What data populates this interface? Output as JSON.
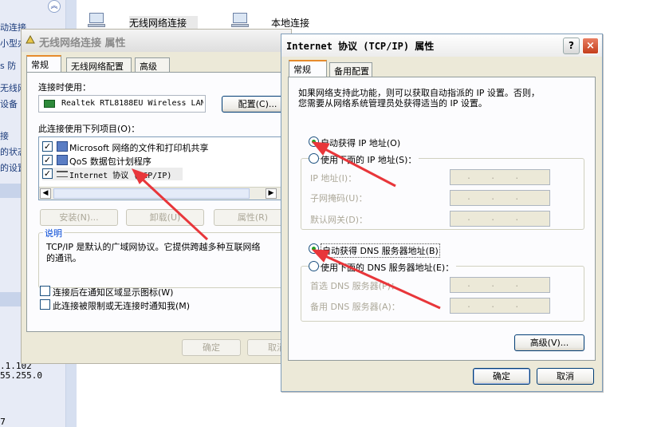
{
  "left_pane": {
    "lines": [
      "动连接",
      "小型办",
      "s 防",
      "无线网",
      "设备",
      "接",
      "的状态",
      "的设置"
    ],
    "ip_fragment": ".1.102",
    "mask_fragment": "55.255.0",
    "bottom_fragment": "7"
  },
  "network_items": [
    {
      "label": "无线网络连接"
    },
    {
      "label": "本地连接"
    }
  ],
  "wlan_dialog": {
    "title": "无线网络连接 属性",
    "tabs": [
      "常规",
      "无线网络配置",
      "高级"
    ],
    "connect_using_label": "连接时使用：",
    "adapter": "Realtek RTL8188EU Wireless LAN",
    "configure_button": "配置(C)...",
    "items_label": "此连接使用下列项目(O)：",
    "items": [
      {
        "label": "Microsoft 网络的文件和打印机共享",
        "checked": true
      },
      {
        "label": "QoS 数据包计划程序",
        "checked": true
      },
      {
        "label": "Internet 协议 (TCP/IP)",
        "checked": true
      }
    ],
    "install_button": "安装(N)...",
    "uninstall_button": "卸载(U)",
    "properties_button": "属性(R)",
    "description_title": "说明",
    "description_text_1": "TCP/IP 是默认的广域网协议。它提供跨越多种互联网络",
    "description_text_2": "的通讯。",
    "show_icon_label": "连接后在通知区域显示图标(W)",
    "notify_label": "此连接被限制或无连接时通知我(M)",
    "ok_button": "确定",
    "cancel_button": "取消"
  },
  "tcpip_dialog": {
    "title": "Internet 协议 (TCP/IP) 属性",
    "help_glyph": "?",
    "close_glyph": "×",
    "tabs": [
      "常规",
      "备用配置"
    ],
    "intro_1": "如果网络支持此功能，则可以获取自动指派的 IP 设置。否则，",
    "intro_2": "您需要从网络系统管理员处获得适当的 IP 设置。",
    "auto_ip_label": "自动获得 IP 地址(O)",
    "manual_ip_label": "使用下面的 IP 地址(S)：",
    "ip_address_label": "IP 地址(I)：",
    "subnet_label": "子网掩码(U)：",
    "gateway_label": "默认网关(D)：",
    "auto_dns_label": "自动获得 DNS 服务器地址(B)",
    "manual_dns_label": "使用下面的 DNS 服务器地址(E)：",
    "preferred_dns_label": "首选 DNS 服务器(P)：",
    "alternate_dns_label": "备用 DNS 服务器(A)：",
    "ip_placeholder": ".    .    .",
    "advanced_button": "高级(V)...",
    "ok_button": "确定",
    "cancel_button": "取消",
    "auto_ip_selected": true,
    "auto_dns_selected": true
  },
  "colors": {
    "annotation_arrow": "#e8363a",
    "dialog_face": "#ece9d8",
    "tab_highlight": "#e68b2c"
  }
}
